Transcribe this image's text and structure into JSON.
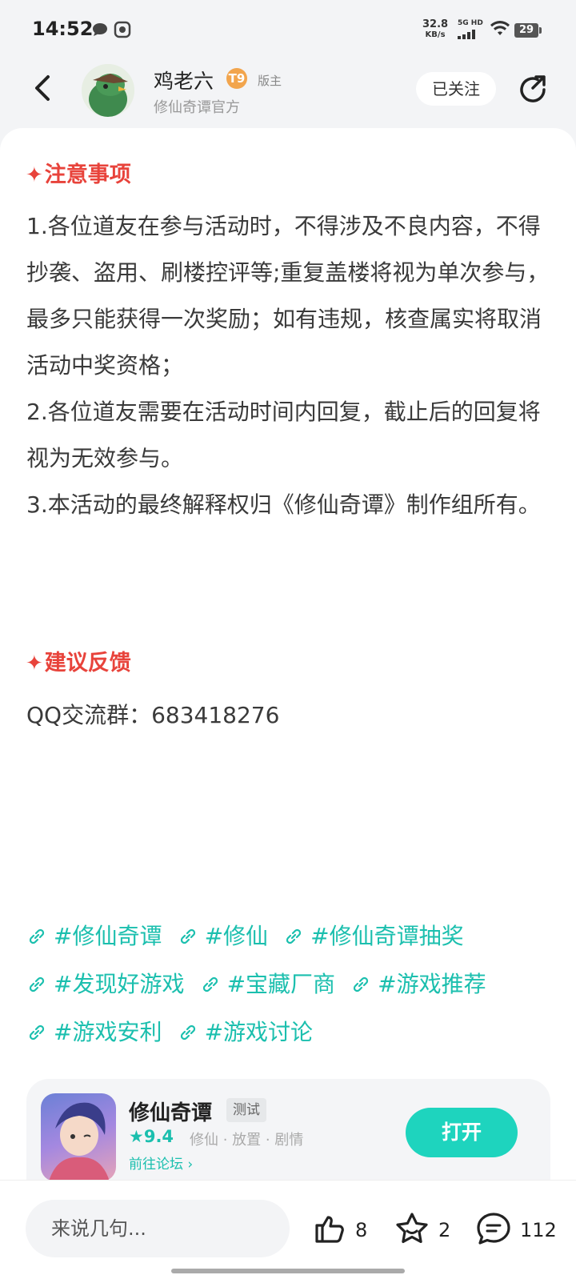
{
  "status_bar": {
    "time": "14:52",
    "speed_value": "32.8",
    "speed_unit": "KB/s",
    "network": "5G HD",
    "battery": "29"
  },
  "header": {
    "author_name": "鸡老六",
    "level_badge": "T9",
    "role": "版主",
    "subtitle": "修仙奇谭官方",
    "follow_label": "已关注"
  },
  "content": {
    "notice_title": "注意事项",
    "notice_items": [
      "1.各位道友在参与活动时，不得涉及不良内容，不得抄袭、盗用、刷楼控评等;重复盖楼将视为单次参与，最多只能获得一次奖励；如有违规，核查属实将取消活动中奖资格；",
      "2.各位道友需要在活动时间内回复，截止后的回复将视为无效参与。",
      "3.本活动的最终解释权归《修仙奇谭》制作组所有。"
    ],
    "feedback_title": "建议反馈",
    "qq_group": "QQ交流群：683418276"
  },
  "tags": [
    [
      "#修仙奇谭",
      "#修仙",
      "#修仙奇谭抽奖"
    ],
    [
      "#发现好游戏",
      "#宝藏厂商",
      "#游戏推荐"
    ],
    [
      "#游戏安利",
      "#游戏讨论"
    ]
  ],
  "game_card": {
    "name": "修仙奇谭",
    "badge": "测试",
    "rating": "9.4",
    "genres": "修仙 · 放置 · 剧情",
    "forum_link": "前往论坛",
    "open_label": "打开"
  },
  "bottom_bar": {
    "comment_placeholder": "来说几句...",
    "likes": "8",
    "favorites": "2",
    "comments": "112"
  },
  "colors": {
    "accent": "#1bbfae",
    "section_title": "#e8433b",
    "open_button": "#1ed4be"
  }
}
